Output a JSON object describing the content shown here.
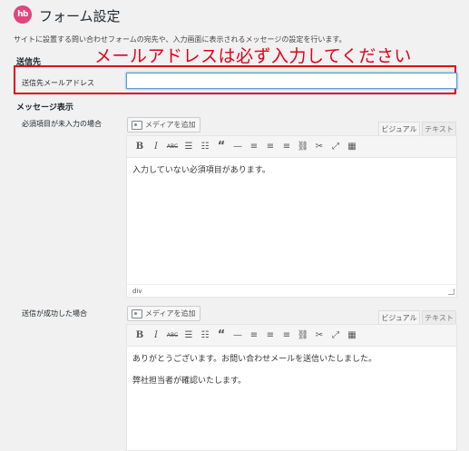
{
  "header": {
    "logo_text": "hb",
    "title": "フォーム設定",
    "description": "サイトに設置する問い合わせフォームの宛先や、入力画面に表示されるメッセージの設定を行います。"
  },
  "sender_section": {
    "heading": "送信先",
    "annotation": "メールアドレスは必ず入力してください",
    "field_label": "送信先メールアドレス",
    "field_value": "",
    "highlight_color": "#e0001a"
  },
  "message_section": {
    "heading": "メッセージ表示",
    "editors": [
      {
        "label": "必須項目が未入力の場合",
        "media_button": "メディアを追加",
        "tab_visual": "ビジュアル",
        "tab_text": "テキスト",
        "content": [
          "入力していない必須項目があります。"
        ],
        "status": "div"
      },
      {
        "label": "送信が成功した場合",
        "media_button": "メディアを追加",
        "tab_visual": "ビジュアル",
        "tab_text": "テキスト",
        "content": [
          "ありがとうございます。お問い合わせメールを送信いたしました。",
          "弊社担当者が確認いたします。"
        ]
      }
    ]
  },
  "toolbar_icons": [
    "bold-icon",
    "italic-icon",
    "strikethrough-icon",
    "bullet-list-icon",
    "numbered-list-icon",
    "blockquote-icon",
    "horizontal-rule-icon",
    "align-left-icon",
    "align-center-icon",
    "align-right-icon",
    "link-icon",
    "unlink-icon",
    "fullscreen-icon",
    "toolbar-toggle-icon"
  ],
  "colors": {
    "accent": "#e0457b",
    "focus": "#5b9dd9"
  }
}
